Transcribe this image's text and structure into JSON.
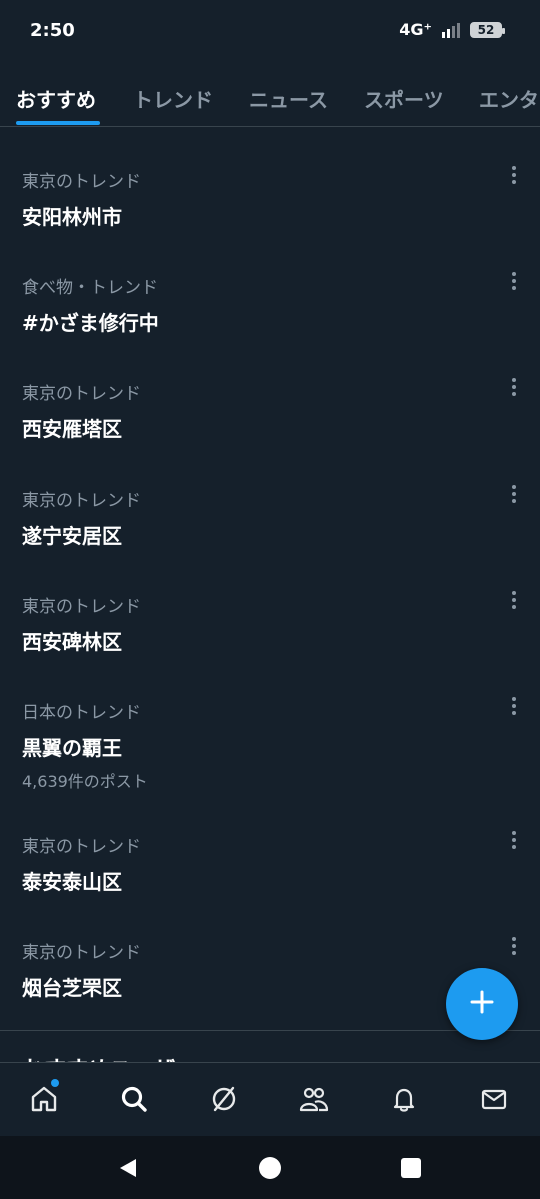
{
  "status": {
    "time": "2:50",
    "network": "4G⁺",
    "battery": "52"
  },
  "tabs": [
    {
      "label": "おすすめ",
      "active": true
    },
    {
      "label": "トレンド"
    },
    {
      "label": "ニュース"
    },
    {
      "label": "スポーツ"
    },
    {
      "label": "エンタ"
    }
  ],
  "trends": [
    {
      "meta": "東京のトレンド",
      "name": "安阳林州市"
    },
    {
      "meta": "食べ物・トレンド",
      "name": "#かざま修行中"
    },
    {
      "meta": "東京のトレンド",
      "name": "西安雁塔区"
    },
    {
      "meta": "東京のトレンド",
      "name": "遂宁安居区"
    },
    {
      "meta": "東京のトレンド",
      "name": "西安碑林区"
    },
    {
      "meta": "日本のトレンド",
      "name": "黒翼の覇王",
      "count": "4,639件のポスト"
    },
    {
      "meta": "東京のトレンド",
      "name": "泰安泰山区"
    },
    {
      "meta": "東京のトレンド",
      "name": "烟台芝罘区"
    }
  ],
  "next_section": "おすすめユーザー",
  "icons": {
    "more": "more-vertical-icon",
    "fab": "plus-icon",
    "nav": [
      "home-icon",
      "search-icon",
      "grok-icon",
      "communities-icon",
      "notifications-icon",
      "messages-icon"
    ],
    "system": [
      "back-icon",
      "home-circle-icon",
      "recents-icon"
    ]
  },
  "colors": {
    "background": "#15202b",
    "accent": "#1d9bf0",
    "secondary_text": "#8b98a5"
  }
}
